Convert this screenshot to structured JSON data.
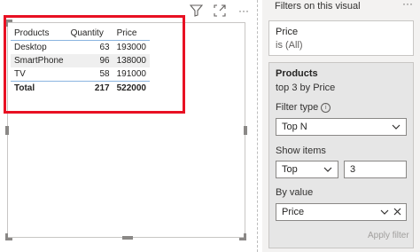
{
  "table": {
    "headers": {
      "products": "Products",
      "quantity": "Quantity",
      "price": "Price"
    },
    "rows": [
      {
        "product": "Desktop",
        "quantity": "63",
        "price": "193000"
      },
      {
        "product": "SmartPhone",
        "quantity": "96",
        "price": "138000"
      },
      {
        "product": "TV",
        "quantity": "58",
        "price": "191000"
      }
    ],
    "total": {
      "label": "Total",
      "quantity": "217",
      "price": "522000"
    }
  },
  "filters_pane": {
    "title": "Filters on this visual",
    "more": "···",
    "price_card": {
      "field": "Price",
      "state": "is (All)"
    },
    "products_card": {
      "field": "Products",
      "summary": "top 3 by Price",
      "filter_type_label": "Filter type",
      "filter_type_value": "Top N",
      "show_items_label": "Show items",
      "show_items_direction": "Top",
      "show_items_count": "3",
      "by_value_label": "By value",
      "by_value_field": "Price",
      "apply_button": "Apply filter"
    }
  },
  "visual_header": {
    "more": "···"
  },
  "colors": {
    "highlight": "#e81123",
    "header_rule": "#8ab4e0",
    "pane_bg": "#f3f2f1"
  }
}
